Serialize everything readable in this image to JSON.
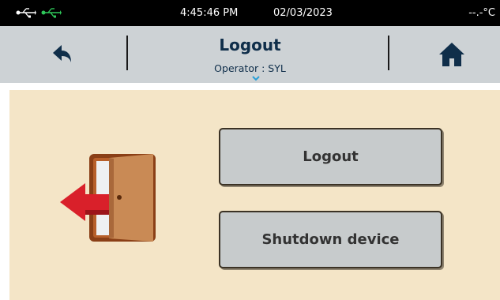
{
  "status_bar": {
    "time": "4:45:46 PM",
    "date": "02/03/2023",
    "temperature": "--.-°C",
    "usb_icons": [
      "usb-icon-white",
      "usb-icon-green"
    ]
  },
  "header": {
    "title": "Logout",
    "operator": "Operator : SYL",
    "back_icon": "back-arrow-icon",
    "home_icon": "home-icon",
    "accent_color": "#0f2e4a"
  },
  "main": {
    "illustration_icon": "exit-door-icon",
    "buttons": {
      "logout_label": "Logout",
      "shutdown_label": "Shutdown device"
    }
  },
  "colors": {
    "header_bg": "#cdd2d5",
    "content_bg": "#f4e5c7",
    "button_bg": "#c7cbcc",
    "usb_green": "#2fc85a"
  }
}
